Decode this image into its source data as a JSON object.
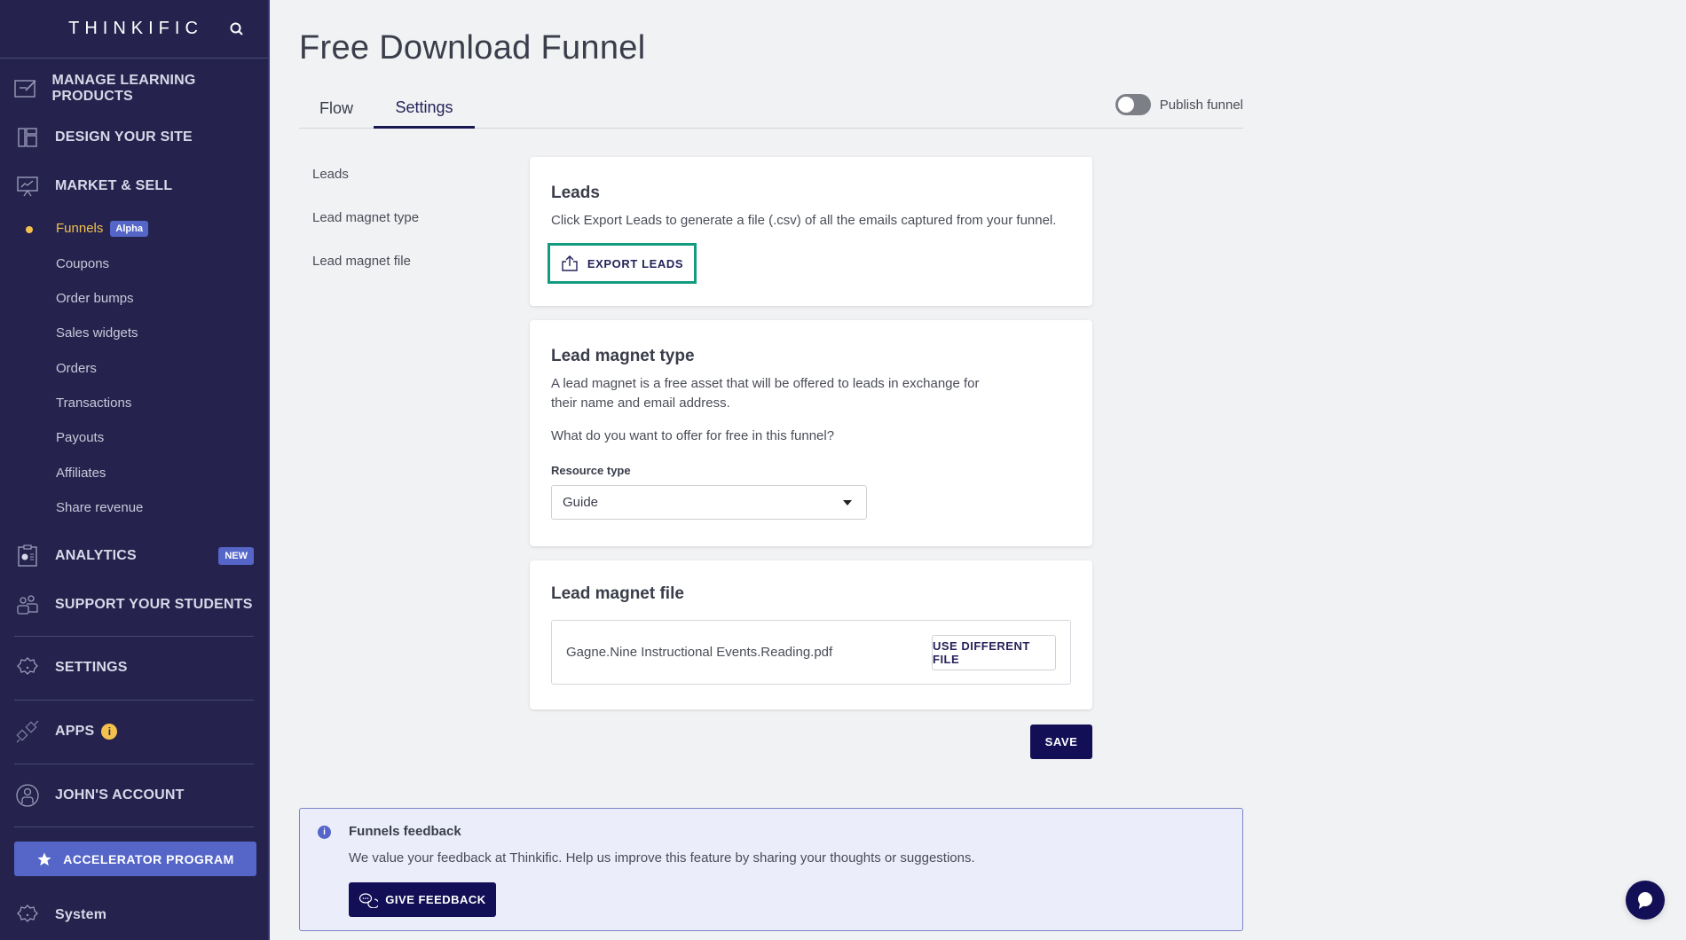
{
  "sidebar": {
    "logo": "THINKIFIC",
    "search_icon": "search-icon",
    "main_items": [
      {
        "label": "MANAGE LEARNING PRODUCTS",
        "icon": "edit-board-icon"
      },
      {
        "label": "DESIGN YOUR SITE",
        "icon": "layout-icon"
      },
      {
        "label": "MARKET & SELL",
        "icon": "presentation-chart-icon"
      },
      {
        "label": "ANALYTICS",
        "icon": "clipboard-chart-icon",
        "badge": "NEW"
      },
      {
        "label": "SUPPORT YOUR STUDENTS",
        "icon": "people-icon"
      },
      {
        "label": "SETTINGS",
        "icon": "gear-icon"
      },
      {
        "label": "APPS",
        "icon": "plug-icon",
        "info_badge": "i"
      },
      {
        "label": "JOHN'S ACCOUNT",
        "icon": "user-circle-icon"
      }
    ],
    "market_sub_items": [
      {
        "label": "Funnels",
        "active": true,
        "badge": "Alpha"
      },
      {
        "label": "Coupons"
      },
      {
        "label": "Order bumps"
      },
      {
        "label": "Sales widgets"
      },
      {
        "label": "Orders"
      },
      {
        "label": "Transactions"
      },
      {
        "label": "Payouts"
      },
      {
        "label": "Affiliates"
      },
      {
        "label": "Share revenue"
      }
    ],
    "accelerator_label": "ACCELERATOR PROGRAM",
    "system_label": "System"
  },
  "page": {
    "title": "Free Download Funnel",
    "tabs": [
      {
        "label": "Flow",
        "active": false
      },
      {
        "label": "Settings",
        "active": true
      }
    ],
    "publish_label": "Publish funnel",
    "publish_on": false
  },
  "section_nav": [
    "Leads",
    "Lead magnet type",
    "Lead magnet file"
  ],
  "leads_card": {
    "title": "Leads",
    "description": "Click Export Leads to generate a file (.csv) of all the emails captured from your funnel.",
    "export_label": "EXPORT LEADS"
  },
  "magnet_type_card": {
    "title": "Lead magnet type",
    "description_line1": "A lead magnet is a free asset that will be offered to leads in exchange for",
    "description_line2": "their name and email address.",
    "question": "What do you want to offer for free in this funnel?",
    "field_label": "Resource type",
    "selected_value": "Guide"
  },
  "magnet_file_card": {
    "title": "Lead magnet file",
    "file_name": "Gagne.Nine Instructional Events.Reading.pdf",
    "change_label": "USE DIFFERENT FILE"
  },
  "save_label": "SAVE",
  "feedback": {
    "title": "Funnels feedback",
    "text": "We value your feedback at Thinkific. Help us improve this feature by sharing your thoughts or suggestions.",
    "button_label": "GIVE FEEDBACK"
  },
  "colors": {
    "sidebar_bg": "#25234d",
    "accent": "#5566c8",
    "active_yellow": "#f3c14d",
    "primary_button": "#130f56",
    "focus_outline": "#139b7f"
  }
}
